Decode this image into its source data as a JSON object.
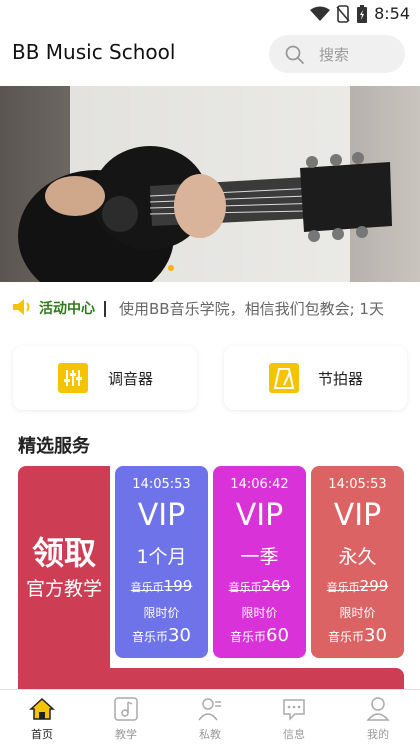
{
  "status_bar": {
    "time": "8:54"
  },
  "header": {
    "title": "BB Music School",
    "search_placeholder": "搜索"
  },
  "banner": {
    "slide_count": 7,
    "active_index": 0
  },
  "notice": {
    "title": "活动中心",
    "text": "使用BB音乐学院，相信我们包教会; 1天"
  },
  "tools": [
    {
      "label": "调音器",
      "icon": "tuner-icon"
    },
    {
      "label": "节拍器",
      "icon": "metronome-icon"
    }
  ],
  "services": {
    "title": "精选服务",
    "claim": {
      "big": "领取",
      "small": "官方教学"
    },
    "vip_cards": [
      {
        "timer": "14:05:53",
        "title": "VIP",
        "period": "1个月",
        "orig_coin": "音乐币",
        "orig_price": "199",
        "limit": "限时价",
        "coin": "音乐币",
        "price": "30",
        "color": "#6f73ea"
      },
      {
        "timer": "14:06:42",
        "title": "VIP",
        "period": "一季",
        "orig_coin": "音乐币",
        "orig_price": "269",
        "limit": "限时价",
        "coin": "音乐币",
        "price": "60",
        "color": "#d932d9"
      },
      {
        "timer": "14:05:53",
        "title": "VIP",
        "period": "永久",
        "orig_coin": "音乐币",
        "orig_price": "299",
        "limit": "限时价",
        "coin": "音乐币",
        "price": "30",
        "color": "#dc6363"
      }
    ]
  },
  "tabbar": {
    "items": [
      {
        "label": "首页",
        "icon": "home-icon",
        "active": true
      },
      {
        "label": "教学",
        "icon": "music-note-icon",
        "active": false
      },
      {
        "label": "私教",
        "icon": "private-tutor-icon",
        "active": false
      },
      {
        "label": "信息",
        "icon": "message-icon",
        "active": false
      },
      {
        "label": "我的",
        "icon": "profile-icon",
        "active": false
      }
    ]
  },
  "colors": {
    "accent": "#f5c400",
    "claim_card": "#cd3e55",
    "notice_title": "#2f7a18"
  }
}
